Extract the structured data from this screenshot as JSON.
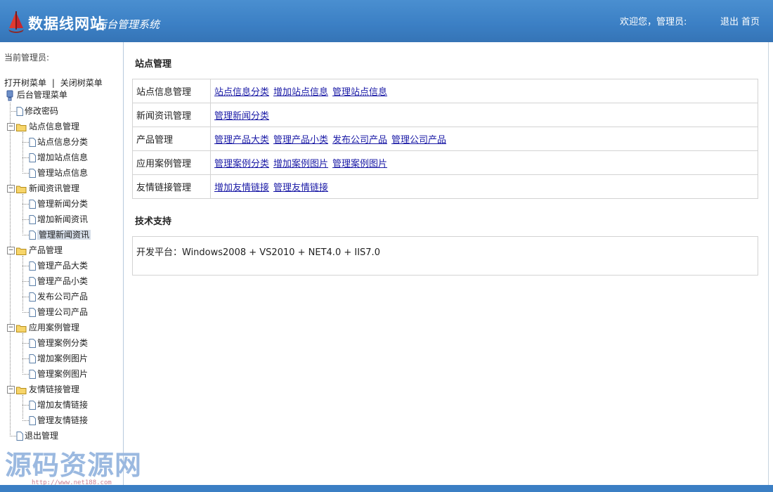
{
  "header": {
    "title": "数据线网站",
    "subtitle": "后台管理系统",
    "welcome": "欢迎您，管理员:",
    "logout": "退出",
    "home": "首页"
  },
  "sidebar": {
    "current_admin": "当前管理员:",
    "open_tree": "打开树菜单",
    "separator": "|",
    "close_tree": "关闭树菜单",
    "root": "后台管理菜单",
    "change_password": "修改密码",
    "groups": [
      {
        "label": "站点信息管理",
        "items": [
          "站点信息分类",
          "增加站点信息",
          "管理站点信息"
        ]
      },
      {
        "label": "新闻资讯管理",
        "items": [
          "管理新闻分类",
          "增加新闻资讯",
          "管理新闻资讯"
        ]
      },
      {
        "label": "产品管理",
        "items": [
          "管理产品大类",
          "管理产品小类",
          "发布公司产品",
          "管理公司产品"
        ]
      },
      {
        "label": "应用案例管理",
        "items": [
          "管理案例分类",
          "增加案例图片",
          "管理案例图片"
        ]
      },
      {
        "label": "友情链接管理",
        "items": [
          "增加友情链接",
          "管理友情链接"
        ]
      }
    ],
    "exit": "退出管理"
  },
  "main": {
    "section1_title": "站点管理",
    "rows": [
      {
        "category": "站点信息管理",
        "links": [
          "站点信息分类",
          "增加站点信息",
          "管理站点信息"
        ]
      },
      {
        "category": "新闻资讯管理",
        "links": [
          "管理新闻分类"
        ]
      },
      {
        "category": "产品管理",
        "links": [
          "管理产品大类",
          "管理产品小类",
          "发布公司产品",
          "管理公司产品"
        ]
      },
      {
        "category": "应用案例管理",
        "links": [
          "管理案例分类",
          "增加案例图片",
          "管理案例图片"
        ]
      },
      {
        "category": "友情链接管理",
        "links": [
          "增加友情链接",
          "管理友情链接"
        ]
      }
    ],
    "section2_title": "技术支持",
    "platform": "开发平台：Windows2008 + VS2010 + NET4.0 + IIS7.0"
  },
  "watermark": {
    "text": "源码资源网",
    "url": "http://www.net188.com"
  },
  "colors": {
    "header_bg": "#3b7fc4",
    "link": "#1a1aa6",
    "selected_bg": "#d5dde8"
  }
}
